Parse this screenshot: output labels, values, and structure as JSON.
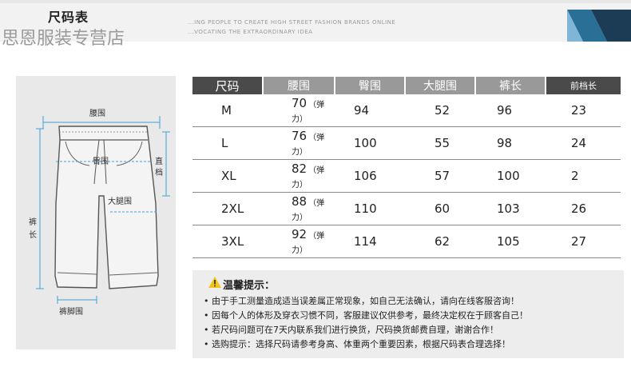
{
  "banner": {
    "title": "尺码表",
    "sub1": "...ING PEOPLE TO CREATE HIGH STREET FASHION BRANDS ONLINE",
    "sub2": "...VOCATING THE EXTRAORDINARY IDEA",
    "watermark": "思恩服装专营店"
  },
  "diagram": {
    "waist": "腰围",
    "hip": "臀围",
    "thigh": "大腿围",
    "rise": [
      "直",
      "档"
    ],
    "length": [
      "裤",
      "长"
    ],
    "hem": "裤脚围"
  },
  "table": {
    "headers": [
      "尺码",
      "腰围",
      "臀围",
      "大腿围",
      "裤长",
      "前档长"
    ],
    "stretch_note": "（弹力）",
    "rows": [
      [
        "M",
        "70",
        "94",
        "52",
        "96",
        "23"
      ],
      [
        "L",
        "76",
        "100",
        "55",
        "98",
        "24"
      ],
      [
        "XL",
        "82",
        "106",
        "57",
        "100",
        "2"
      ],
      [
        "2XL",
        "88",
        "110",
        "60",
        "103",
        "26"
      ],
      [
        "3XL",
        "92",
        "114",
        "62",
        "105",
        "27"
      ]
    ]
  },
  "tips": {
    "title": "温馨提示：",
    "lines": [
      "• 由于手工测量造成适当误差属正常现象，如自己无法确认，请向在线客服咨询！",
      "• 因每个人的体形及穿衣习惯不同，客服建议仅供参考，最终决定权在于顾客自己！",
      "• 若尺码问题可在7天内联系我们进行换货，尺码换货邮费自理，谢谢合作！",
      "• 选购提示：选择尺码请参考身高、体重两个重要因素，根据尺码表合理选择！"
    ]
  },
  "colors": {
    "header_dark": "#4a4a4a",
    "header_gray": "#999999",
    "accent_blue": "#3f9fd8",
    "warning_yellow": "#f2c318"
  }
}
